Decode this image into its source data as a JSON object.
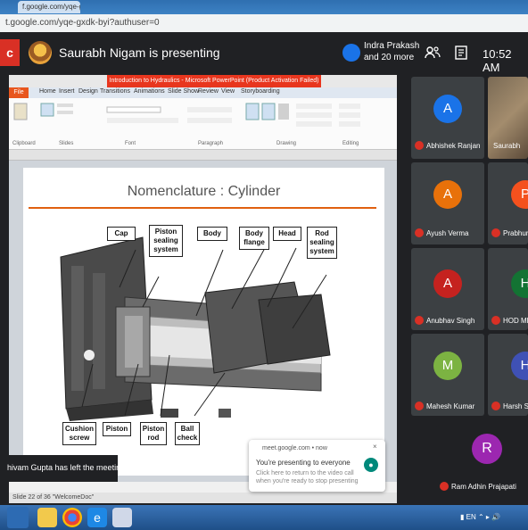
{
  "browser": {
    "tab_title": "f.google.com/yqe-gxdk-byi?authuser=0",
    "url": "t.google.com/yqe-gxdk-byi?authuser=0"
  },
  "meet": {
    "presenting_text": "Saurabh Nigam is presenting",
    "viewer_name": "Indra Prakash",
    "viewer_more": "and 20 more",
    "clock": "10:52 AM",
    "left_notification": "hivam Gupta has left the meeting"
  },
  "powerpoint": {
    "title_bar": "Introduction to Hydraulics - Microsoft PowerPoint (Product Activation Failed)",
    "file_tab": "File",
    "tabs": [
      "Home",
      "Insert",
      "Design",
      "Transitions",
      "Animations",
      "Slide Show",
      "Review",
      "View",
      "Storyboarding"
    ],
    "ribbon_groups": [
      "Clipboard",
      "Slides",
      "Font",
      "Paragraph",
      "Drawing",
      "Editing"
    ],
    "status": "Slide 22 of 36   \"WelcomeDoc\""
  },
  "slide": {
    "title": "Nomenclature : Cylinder",
    "labels": {
      "cap": "Cap",
      "piston_sealing": "Piston sealing system",
      "body": "Body",
      "body_flange": "Body flange",
      "head": "Head",
      "rod_sealing": "Rod sealing system",
      "cushion_screw": "Cushion screw",
      "piston": "Piston",
      "piston_rod": "Piston rod",
      "ball_check": "Ball check"
    }
  },
  "present_toast": {
    "source": "meet.google.com • now",
    "title": "You're presenting to everyone",
    "body": "Click here to return to the video call when you're ready to stop presenting",
    "close": "×"
  },
  "participants": [
    {
      "initial": "A",
      "name": "Abhishek Ranjan",
      "color": "#1a73e8"
    },
    {
      "initial": "",
      "name": "Saurabh",
      "color": "#5f6368"
    },
    {
      "initial": "A",
      "name": "Ayush Verma",
      "color": "#e8710a"
    },
    {
      "initial": "P",
      "name": "Prabhun",
      "color": "#f4511e"
    },
    {
      "initial": "A",
      "name": "Anubhav Singh",
      "color": "#c5221f"
    },
    {
      "initial": "H",
      "name": "HOD ME",
      "color": "#137333"
    },
    {
      "initial": "M",
      "name": "Mahesh Kumar",
      "color": "#7cb342"
    },
    {
      "initial": "H",
      "name": "Harsh S",
      "color": "#3f51b5"
    },
    {
      "initial": "R",
      "name": "Ram Adhin Prajapati",
      "color": "#9c27b0"
    }
  ],
  "colors": {
    "meet_bg": "#202124",
    "accent_red": "#d93025",
    "ppt_orange": "#e8361e",
    "slide_rule": "#e06010"
  }
}
